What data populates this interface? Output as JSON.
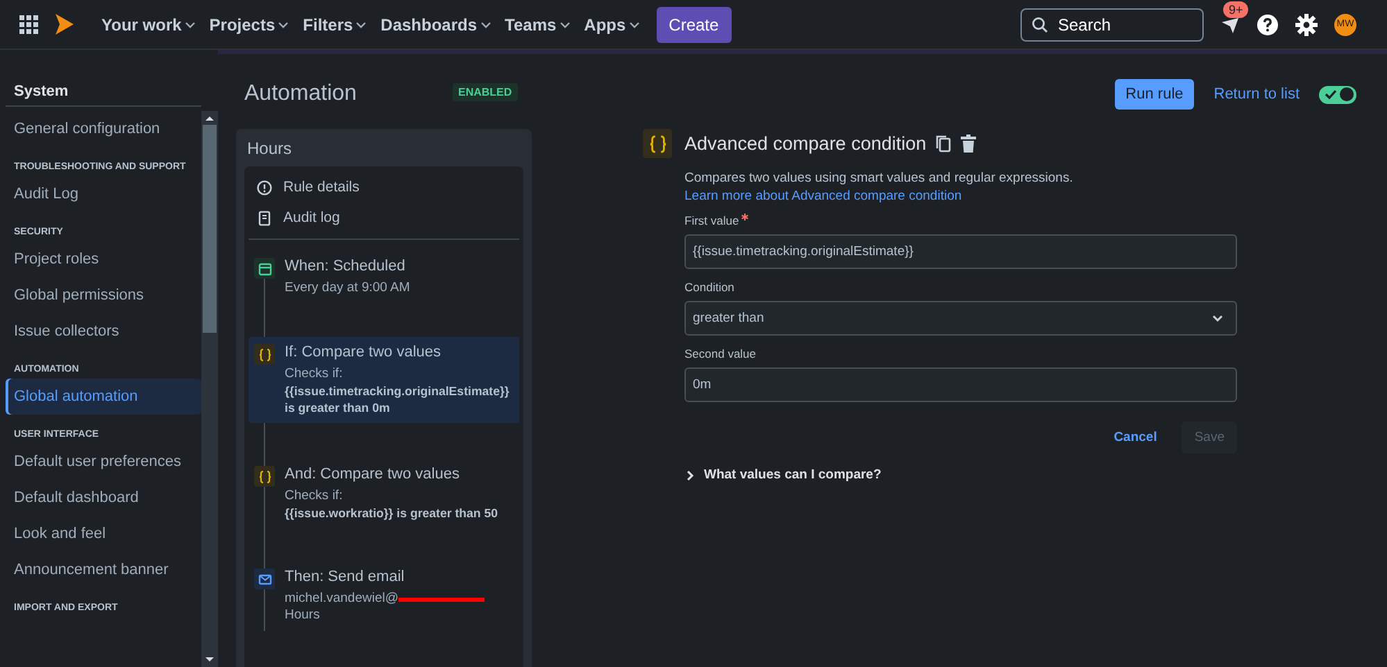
{
  "nav": {
    "items": [
      {
        "label": "Your work"
      },
      {
        "label": "Projects"
      },
      {
        "label": "Filters"
      },
      {
        "label": "Dashboards"
      },
      {
        "label": "Teams"
      },
      {
        "label": "Apps"
      }
    ],
    "create": "Create",
    "search": {
      "placeholder": "Search"
    },
    "notifications": "9+",
    "avatar": "MW"
  },
  "sidebar": {
    "title": "System",
    "items": [
      {
        "kind": "link",
        "label": "General configuration",
        "selected": false
      },
      {
        "kind": "heading",
        "label": "TROUBLESHOOTING AND SUPPORT"
      },
      {
        "kind": "link",
        "label": "Audit Log",
        "selected": false
      },
      {
        "kind": "heading",
        "label": "SECURITY"
      },
      {
        "kind": "link",
        "label": "Project roles",
        "selected": false
      },
      {
        "kind": "link",
        "label": "Global permissions",
        "selected": false
      },
      {
        "kind": "link",
        "label": "Issue collectors",
        "selected": false
      },
      {
        "kind": "heading",
        "label": "AUTOMATION"
      },
      {
        "kind": "link",
        "label": "Global automation",
        "selected": true
      },
      {
        "kind": "heading",
        "label": "USER INTERFACE"
      },
      {
        "kind": "link",
        "label": "Default user preferences",
        "selected": false
      },
      {
        "kind": "link",
        "label": "Default dashboard",
        "selected": false
      },
      {
        "kind": "link",
        "label": "Look and feel",
        "selected": false
      },
      {
        "kind": "link",
        "label": "Announcement banner",
        "selected": false
      },
      {
        "kind": "heading",
        "label": "IMPORT AND EXPORT"
      }
    ]
  },
  "page": {
    "title": "Automation",
    "status": "ENABLED",
    "run_rule": "Run rule",
    "return_to_list": "Return to list",
    "enabled": true
  },
  "rule": {
    "name": "Hours",
    "menu": [
      {
        "kind": "info",
        "label": "Rule details"
      },
      {
        "kind": "log",
        "label": "Audit log"
      }
    ],
    "steps": [
      {
        "kind": "trigger",
        "title": "When: Scheduled",
        "selected": false,
        "lines": [
          "Every day at 9:00 AM"
        ]
      },
      {
        "kind": "condition",
        "title": "If: Compare two values",
        "selected": true,
        "lines": [
          "Checks if:"
        ],
        "expression": "{{issue.timetracking.originalEstimate}} is greater than 0m"
      },
      {
        "kind": "condition",
        "title": "And: Compare two values",
        "selected": false,
        "lines": [
          "Checks if:"
        ],
        "expression": "{{issue.workratio}} is greater than 50"
      },
      {
        "kind": "action",
        "title": "Then: Send email",
        "selected": false,
        "redacted": true,
        "lines": [
          "michel.vandewiel@",
          "Hours"
        ]
      }
    ]
  },
  "editor": {
    "title": "Advanced compare condition",
    "description": "Compares two values using smart values and regular expressions.",
    "link": "Learn more about Advanced compare condition",
    "fields": [
      {
        "kind": "text",
        "label": "First value",
        "required": true,
        "value": "{{issue.timetracking.originalEstimate}}"
      },
      {
        "kind": "select",
        "label": "Condition",
        "required": false,
        "value": "greater than"
      },
      {
        "kind": "text",
        "label": "Second value",
        "required": false,
        "value": "0m"
      }
    ],
    "cancel": "Cancel",
    "save": {
      "label": "Save",
      "disabled": true
    },
    "expander": {
      "label": "What values can I compare?",
      "expanded": false
    }
  }
}
